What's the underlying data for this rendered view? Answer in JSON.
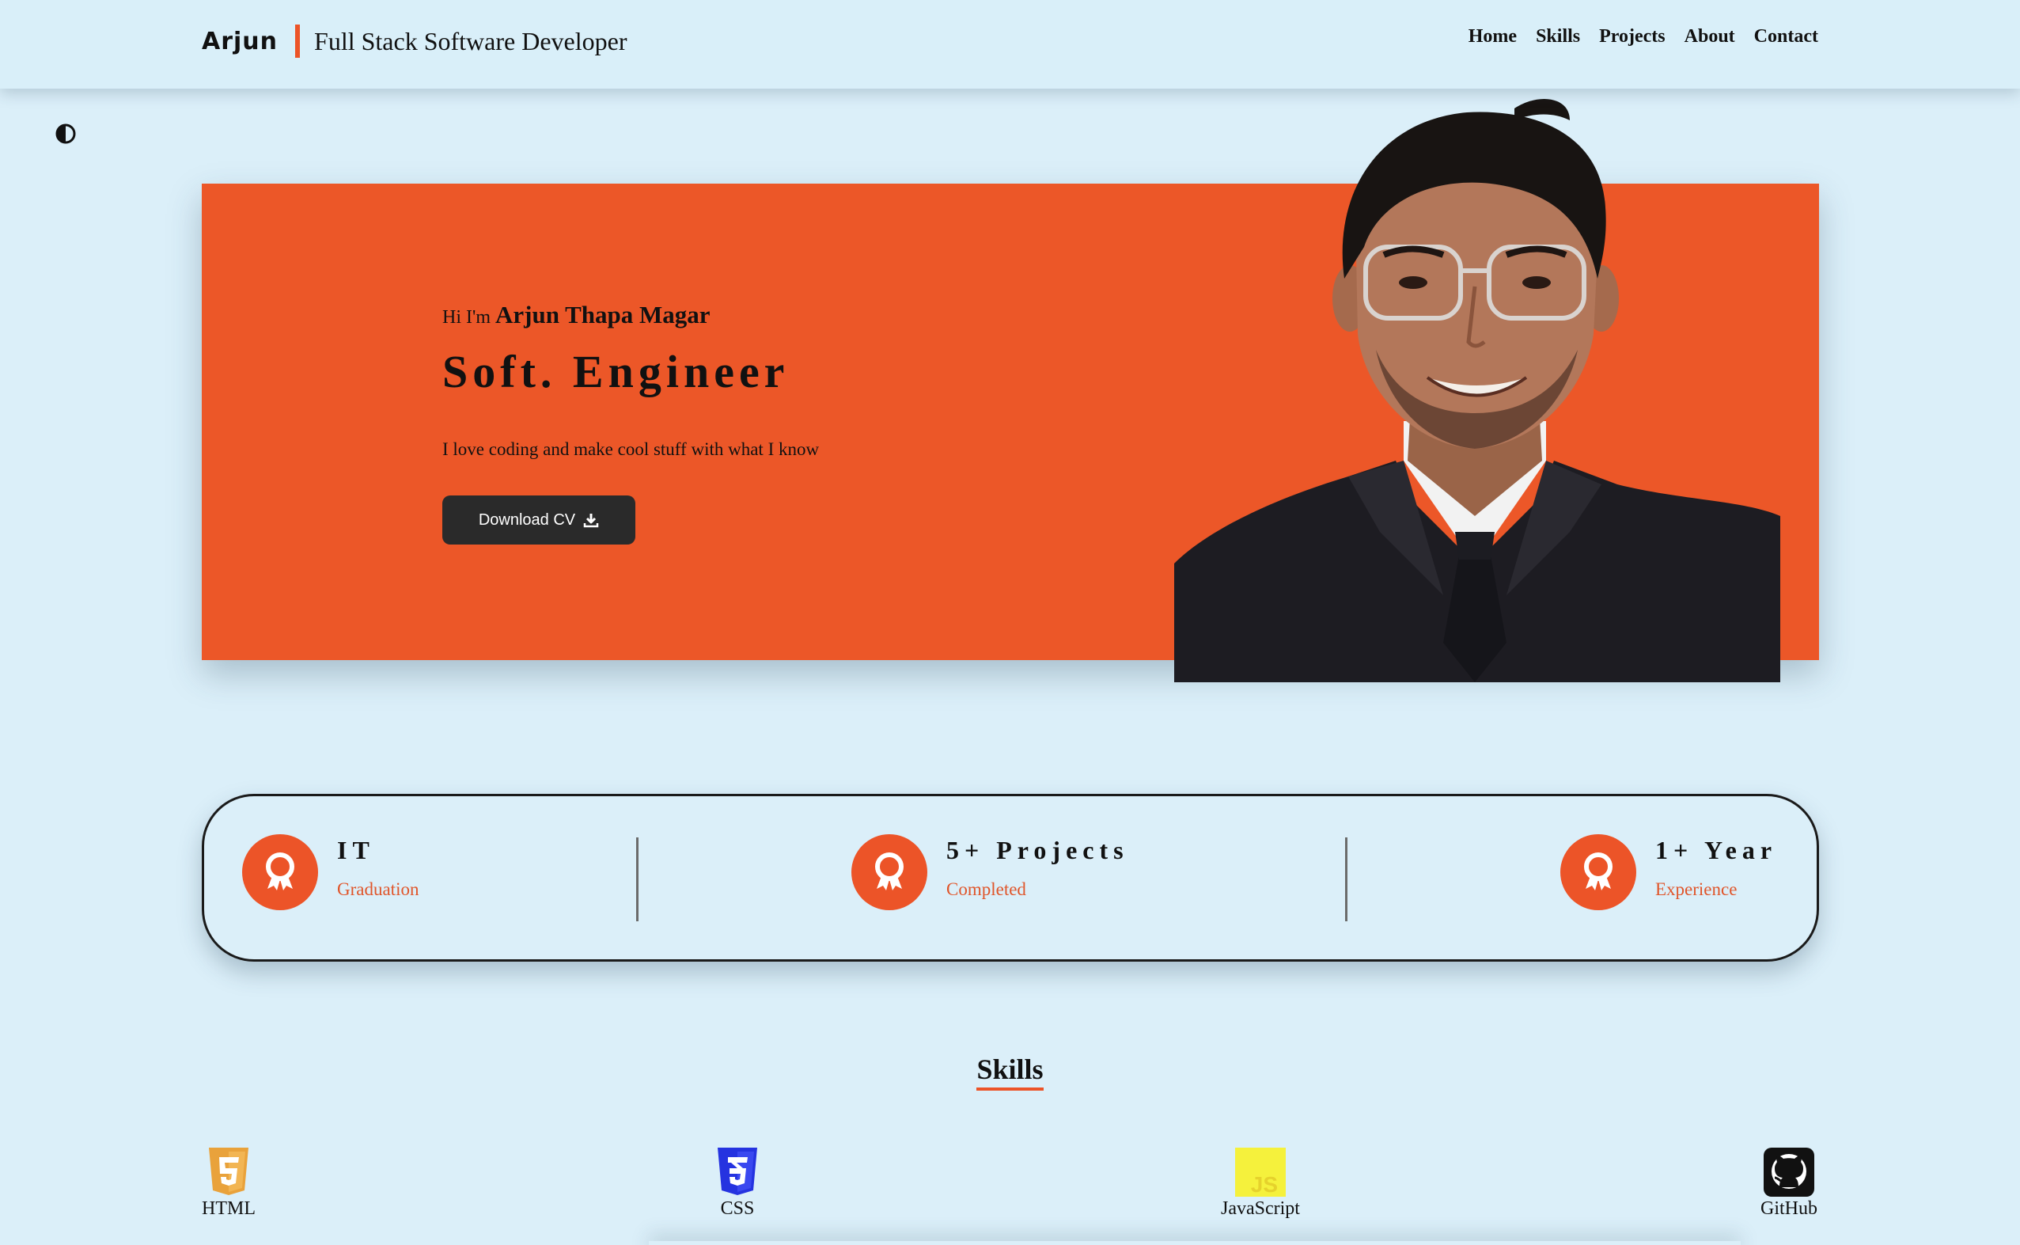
{
  "header": {
    "brand_name": "Arjun",
    "brand_role": "Full Stack Software Developer",
    "nav": [
      "Home",
      "Skills",
      "Projects",
      "About",
      "Contact"
    ]
  },
  "theme_toggle_icon": "half-circle-contrast-icon",
  "hero": {
    "greeting_prefix": "Hi I'm",
    "full_name": "Arjun Thapa Magar",
    "role_title": "Soft. Engineer",
    "tagline": "I love coding and make cool stuff with what I know",
    "cv_button_label": "Download CV",
    "cv_button_icon": "download-icon",
    "accent_color": "#ec5728"
  },
  "stats": [
    {
      "title": "IT",
      "subtitle": "Graduation",
      "icon": "award-ribbon-icon"
    },
    {
      "title": "5+ Projects",
      "subtitle": "Completed",
      "icon": "award-ribbon-icon"
    },
    {
      "title": "1+ Year",
      "subtitle": "Experience",
      "icon": "award-ribbon-icon"
    }
  ],
  "skills": {
    "heading": "Skills",
    "items": [
      {
        "label": "HTML",
        "icon": "html5-icon",
        "color": "#e9a23b"
      },
      {
        "label": "CSS",
        "icon": "css3-icon",
        "color": "#2533e0"
      },
      {
        "label": "JavaScript",
        "icon": "javascript-icon",
        "color": "#f5f13c"
      },
      {
        "label": "GitHub",
        "icon": "github-icon",
        "color": "#111111"
      }
    ]
  }
}
